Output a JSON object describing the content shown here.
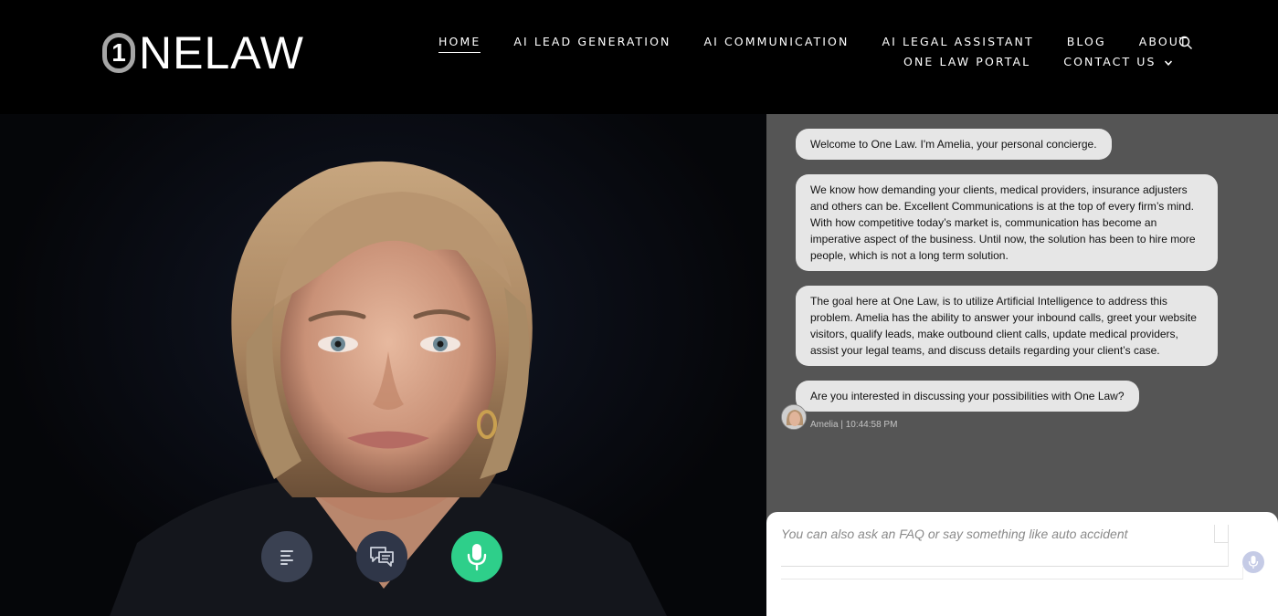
{
  "brand": {
    "logo_numeral": "1",
    "logo_text": "NELAW"
  },
  "nav": {
    "row1": [
      {
        "label": "HOME",
        "active": true
      },
      {
        "label": "AI LEAD GENERATION"
      },
      {
        "label": "AI COMMUNICATION"
      },
      {
        "label": "AI LEGAL ASSISTANT"
      },
      {
        "label": "BLOG"
      },
      {
        "label": "ABOUT"
      }
    ],
    "row2": [
      {
        "label": "ONE LAW PORTAL"
      },
      {
        "label": "CONTACT US"
      }
    ],
    "search_icon": "search-icon",
    "dropdown_icon": "chevron-down-icon"
  },
  "controls": {
    "menu_icon": "menu-lines-icon",
    "chat_icon": "chat-bubbles-icon",
    "mic_icon": "microphone-icon",
    "mic_color": "#2ecf8a"
  },
  "chat": {
    "messages": [
      "Welcome to One Law. I'm Amelia, your personal concierge.",
      "We know how demanding your clients, medical providers, insurance adjusters and others can be. Excellent Communications is at the top of every firm’s mind. With how competitive today’s market is, communication has become an imperative aspect of the business. Until now, the solution has been to hire more people, which is not a long term solution.",
      "The goal here at One Law, is to utilize Artificial Intelligence to address this problem. Amelia has the ability to answer your inbound calls, greet your website visitors, qualify leads, make outbound client calls, update medical providers, assist your legal teams, and discuss details regarding your client’s case.",
      "Are you interested in discussing your possibilities with One Law?"
    ],
    "meta": "Amelia | 10:44:58 PM",
    "input_placeholder": "You can also ask an FAQ or say something like auto accident",
    "input_value": ""
  },
  "colors": {
    "header_bg": "#000000",
    "chat_bg": "#555555",
    "bubble_bg": "#e6e6e6"
  }
}
